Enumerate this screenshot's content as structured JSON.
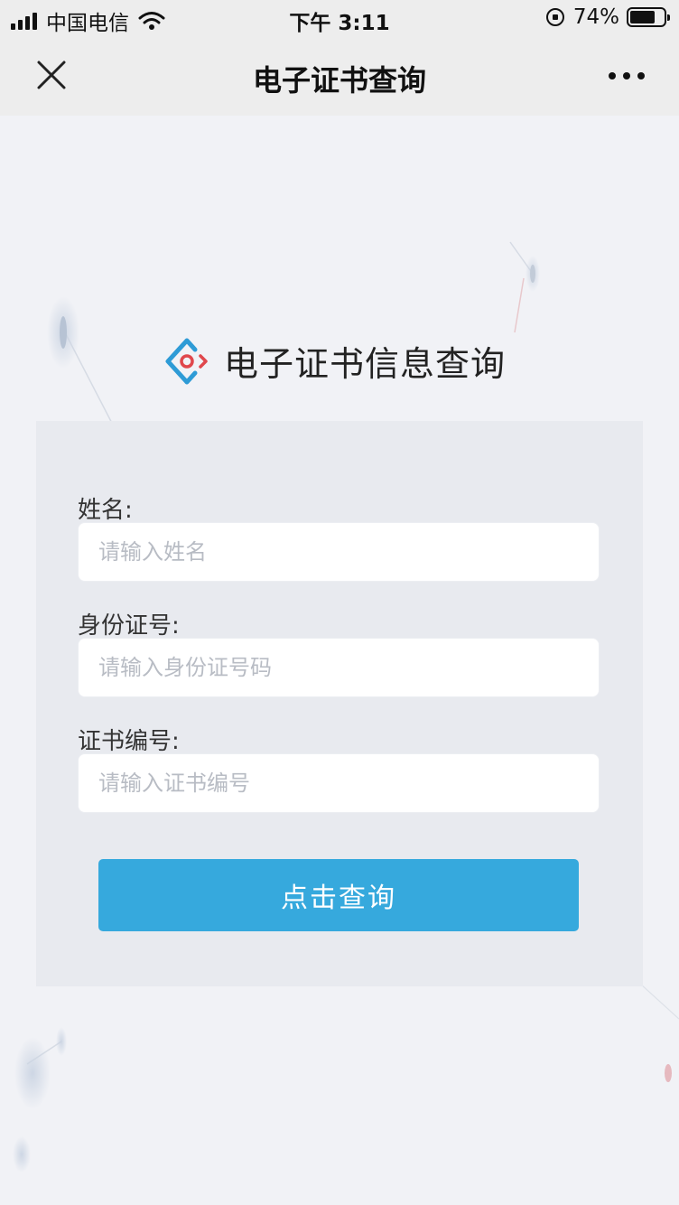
{
  "status_bar": {
    "carrier": "中国电信",
    "time": "下午 3:11",
    "battery": "74%",
    "battery_level": 0.74
  },
  "nav": {
    "title": "电子证书查询",
    "close_icon": "close-icon",
    "more_icon": "more-dots-icon"
  },
  "header": {
    "title": "电子证书信息查询",
    "logo_colors": {
      "blue": "#2e9bd6",
      "red": "#e0474c"
    }
  },
  "form": {
    "name_label": "姓名:",
    "name_placeholder": "请输入姓名",
    "id_label": "身份证号:",
    "id_placeholder": "请输入身份证号码",
    "cert_label": "证书编号:",
    "cert_placeholder": "请输入证书编号",
    "submit_label": "点击查询"
  },
  "colors": {
    "accent": "#36a9dd",
    "navbar_bg": "#ededed",
    "page_bg": "#f1f2f6",
    "card_bg": "#e8eaef"
  }
}
